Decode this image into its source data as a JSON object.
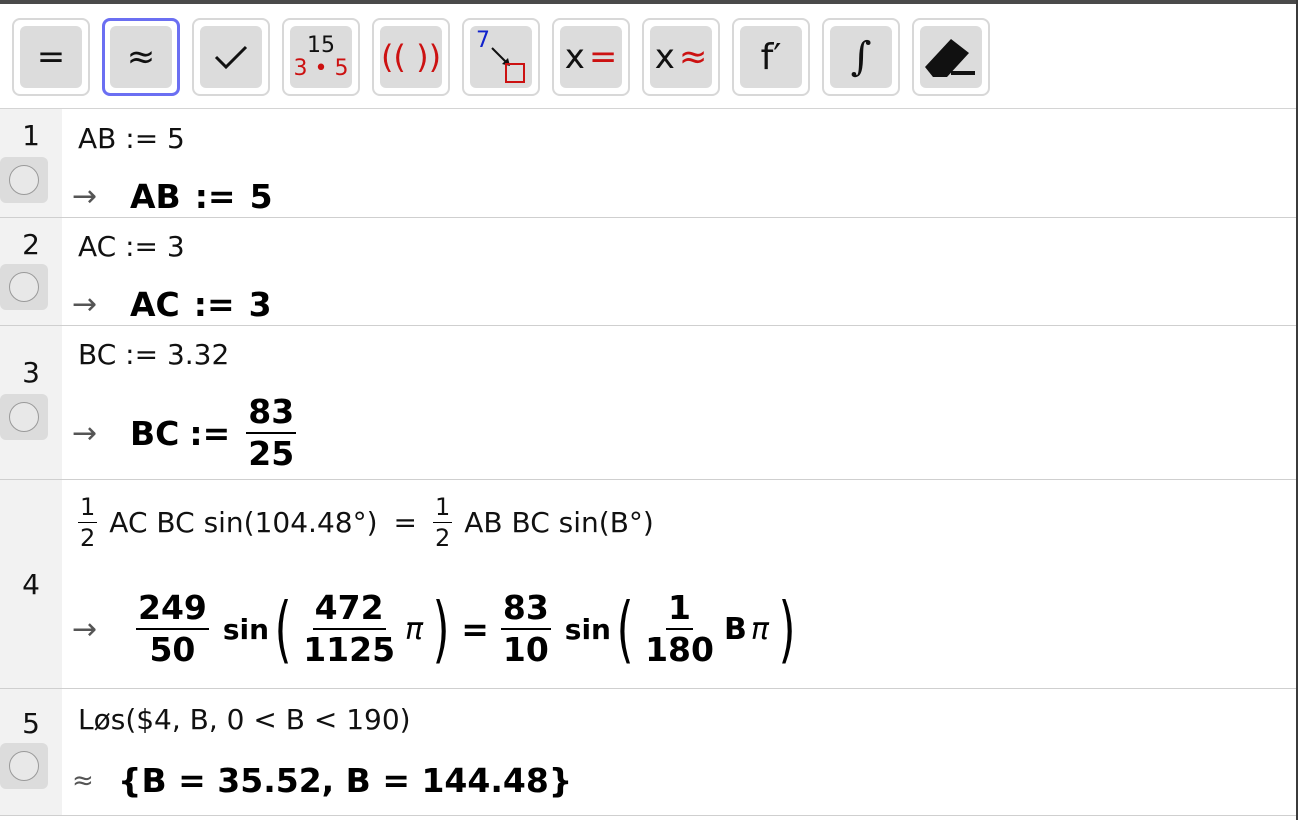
{
  "toolbar": {
    "evaluate": "=",
    "numeric": "≈",
    "keep_input": "✓",
    "factor_top": "15",
    "factor_bottom": "3 • 5",
    "expand": "(( ))",
    "substitute_num": "7",
    "solve_x": "x",
    "solve_eq": "=",
    "nsolve_x": "x",
    "nsolve_eq": "≈",
    "derivative": "f′",
    "integral": "∫"
  },
  "rows": [
    {
      "num": "1",
      "input": "AB := 5",
      "arrow": "→",
      "out_lhs": "AB",
      "out_op": ":=",
      "out_rhs": "5"
    },
    {
      "num": "2",
      "input": "AC := 3",
      "arrow": "→",
      "out_lhs": "AC",
      "out_op": ":=",
      "out_rhs": "3"
    },
    {
      "num": "3",
      "input": "BC := 3.32",
      "arrow": "→",
      "out_lhs": "BC",
      "out_op": ":=",
      "num_top": "83",
      "num_bottom": "25"
    },
    {
      "num": "4",
      "in_frac_n": "1",
      "in_frac_d": "2",
      "in_lhs": "AC BC  sin(104.48°)",
      "in_eq": "=",
      "in_rhs": "AB BC  sin(B°)",
      "arrow": "→",
      "f1n": "249",
      "f1d": "50",
      "sin": "sin",
      "f2n": "472",
      "f2d": "1125",
      "pi": "π",
      "eq": "=",
      "f3n": "83",
      "f3d": "10",
      "f4n": "1",
      "f4d": "180",
      "b": "B"
    },
    {
      "num": "5",
      "input": "Løs($4,  B,  0 < B < 190)",
      "arrow": "≈",
      "output": "{B = 35.52, B = 144.48}"
    }
  ]
}
